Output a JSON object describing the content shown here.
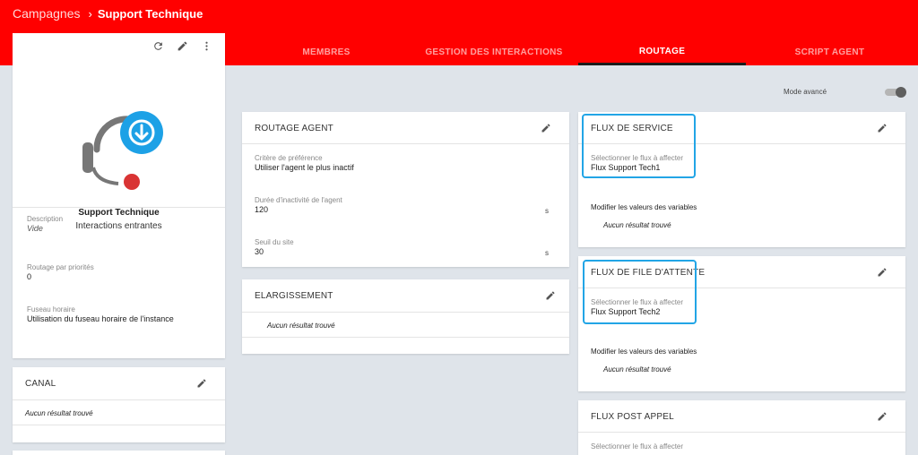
{
  "breadcrumb": {
    "root": "Campagnes",
    "current": "Support Technique"
  },
  "tabs": [
    {
      "label": "MEMBRES",
      "active": false
    },
    {
      "label": "GESTION DES INTERACTIONS",
      "active": false
    },
    {
      "label": "ROUTAGE",
      "active": true
    },
    {
      "label": "SCRIPT AGENT",
      "active": false
    }
  ],
  "mode": {
    "label": "Mode avancé",
    "enabled": true
  },
  "profile": {
    "name": "Support Technique",
    "type": "Interactions entrantes",
    "fields": [
      {
        "label": "Description",
        "value": "Vide"
      },
      {
        "label": "Routage par priorités",
        "value": "0"
      },
      {
        "label": "Fuseau horaire",
        "value": "Utilisation du fuseau horaire de l'instance"
      }
    ]
  },
  "canal": {
    "title": "CANAL",
    "empty": "Aucun résultat trouvé"
  },
  "routage_agent": {
    "title": "ROUTAGE AGENT",
    "fields": [
      {
        "label": "Critère de préférence",
        "value": "Utiliser l'agent le plus inactif",
        "unit": ""
      },
      {
        "label": "Durée d'inactivité de l'agent",
        "value": "120",
        "unit": "s"
      },
      {
        "label": "Seuil du site",
        "value": "30",
        "unit": "s"
      }
    ]
  },
  "elargissement": {
    "title": "ELARGISSEMENT",
    "empty": "Aucun résultat trouvé"
  },
  "flux_service": {
    "title": "FLUX DE SERVICE",
    "select_label": "Sélectionner le flux à affecter",
    "select_value": "Flux Support Tech1",
    "vars_label": "Modifier les valeurs des variables",
    "empty": "Aucun résultat trouvé"
  },
  "flux_file": {
    "title": "FLUX DE FILE D'ATTENTE",
    "select_label": "Sélectionner le flux à affecter",
    "select_value": "Flux Support Tech2",
    "vars_label": "Modifier les valeurs des variables",
    "empty": "Aucun résultat trouvé"
  },
  "flux_post": {
    "title": "FLUX POST APPEL",
    "select_label": "Sélectionner le flux à affecter"
  },
  "colors": {
    "brand": "#ff0000",
    "highlight": "#22a5e6",
    "avatar_badge": "#1da1e6",
    "avatar_dot": "#d93434"
  },
  "icons": [
    "chevron-right-icon",
    "refresh-icon",
    "pencil-icon",
    "more-vert-icon",
    "headset-icon",
    "download-icon"
  ]
}
